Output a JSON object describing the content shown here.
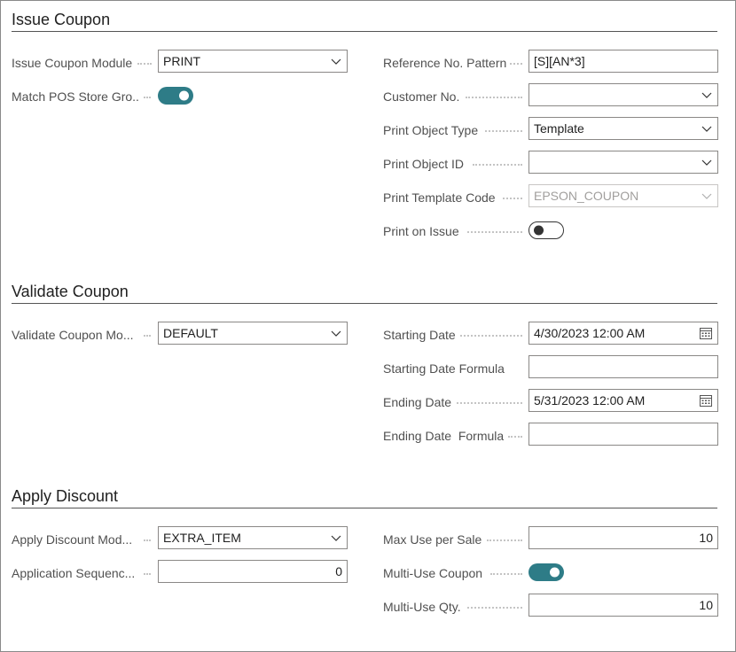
{
  "issue_coupon": {
    "title": "Issue Coupon",
    "issue_coupon_module": {
      "label": "Issue Coupon Module",
      "value": "PRINT"
    },
    "match_pos_store_group": {
      "label": "Match POS Store Gro...",
      "on": true
    },
    "reference_no_pattern": {
      "label": "Reference No. Pattern",
      "value": "[S][AN*3]"
    },
    "customer_no": {
      "label": "Customer No.",
      "value": ""
    },
    "print_object_type": {
      "label": "Print Object Type",
      "value": "Template"
    },
    "print_object_id": {
      "label": "Print Object ID",
      "value": ""
    },
    "print_template_code": {
      "label": "Print Template Code",
      "value": "EPSON_COUPON"
    },
    "print_on_issue": {
      "label": "Print on Issue",
      "on": false
    }
  },
  "validate_coupon": {
    "title": "Validate Coupon",
    "validate_coupon_module": {
      "label": "Validate Coupon Mo...",
      "value": "DEFAULT"
    },
    "starting_date": {
      "label": "Starting Date",
      "value": "4/30/2023 12:00 AM"
    },
    "starting_date_formula": {
      "label": "Starting Date Formula",
      "value": ""
    },
    "ending_date": {
      "label": "Ending Date",
      "value": "5/31/2023 12:00 AM"
    },
    "ending_date_formula": {
      "label": "Ending Date  Formula",
      "value": ""
    }
  },
  "apply_discount": {
    "title": "Apply Discount",
    "apply_discount_module": {
      "label": "Apply Discount Mod...",
      "value": "EXTRA_ITEM"
    },
    "application_sequence": {
      "label": "Application Sequenc...",
      "value": "0"
    },
    "max_use_per_sale": {
      "label": "Max Use per Sale",
      "value": "10"
    },
    "multi_use_coupon": {
      "label": "Multi-Use Coupon",
      "on": true
    },
    "multi_use_qty": {
      "label": "Multi-Use Qty.",
      "value": "10"
    }
  },
  "icons": {
    "dropdown": "chevron-down-icon",
    "date_picker": "calendar-icon"
  },
  "colors": {
    "toggle_on": "#2e7c87",
    "label": "#505050",
    "field_border": "#8a8886"
  }
}
